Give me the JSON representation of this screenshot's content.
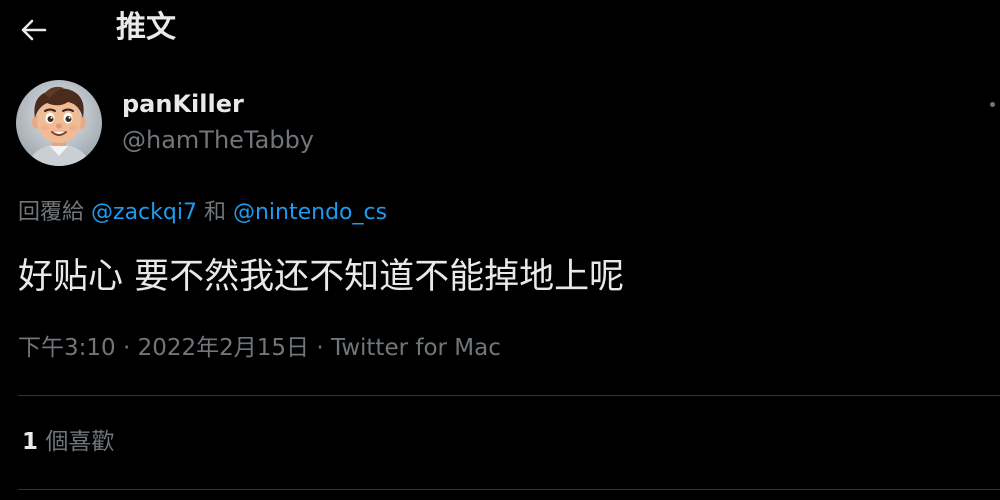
{
  "header": {
    "title": "推文",
    "back_icon": "arrow-left-icon"
  },
  "author": {
    "display_name": "panKiller",
    "handle": "@hamTheTabby",
    "avatar_icon": "cartoon-boy-avatar"
  },
  "reply": {
    "prefix": "回覆給",
    "mention_1": "@zackqi7",
    "joiner": "和",
    "mention_2": "@nintendo_cs"
  },
  "tweet": {
    "text": "好贴心 要不然我还不知道不能掉地上呢"
  },
  "meta": {
    "time": "下午3:10",
    "separator": "·",
    "date": "2022年2月15日",
    "source": "Twitter for Mac"
  },
  "stats": {
    "likes_count": "1",
    "likes_label": "個喜歡"
  },
  "colors": {
    "background": "#000000",
    "primary_text": "#e7e9ea",
    "secondary_text": "#71767b",
    "link": "#1d9bf0",
    "divider": "#2f3336"
  }
}
